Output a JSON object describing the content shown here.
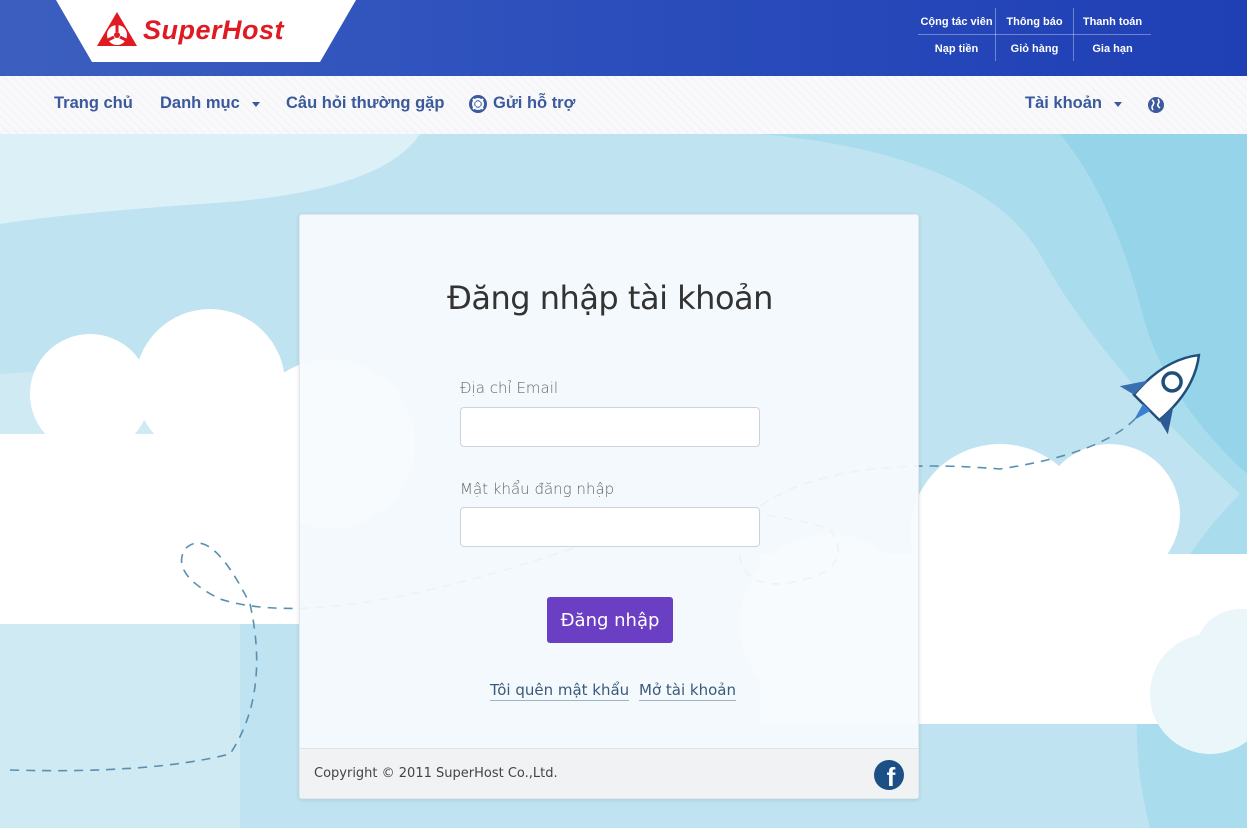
{
  "brand": {
    "name": "SuperHost",
    "color": "#e01a22"
  },
  "topbar": {
    "links": [
      {
        "label": "Cộng tác viên"
      },
      {
        "label": "Thông báo"
      },
      {
        "label": "Thanh toán"
      },
      {
        "label": "Nạp tiền"
      },
      {
        "label": "Giỏ hàng"
      },
      {
        "label": "Gia hạn"
      }
    ]
  },
  "nav": {
    "home": "Trang chủ",
    "categories": "Danh mục",
    "faq": "Câu hỏi thường gặp",
    "support": "Gửi hỗ trợ",
    "account": "Tài khoản"
  },
  "login": {
    "title": "Đăng nhập tài khoản",
    "email_label": "Địa chỉ Email",
    "email_value": "",
    "password_label": "Mật khẩu đăng nhập",
    "password_value": "",
    "submit": "Đăng nhập",
    "forgot": "Tôi quên mật khẩu",
    "register": "Mở tài khoản"
  },
  "footer": {
    "copyright": "Copyright © 2011 SuperHost Co.,Ltd."
  },
  "colors": {
    "topbar": "#2c4fbc",
    "nav_text": "#3a5a9c",
    "button": "#6b3fc4",
    "sky": "#bfe3f0"
  }
}
